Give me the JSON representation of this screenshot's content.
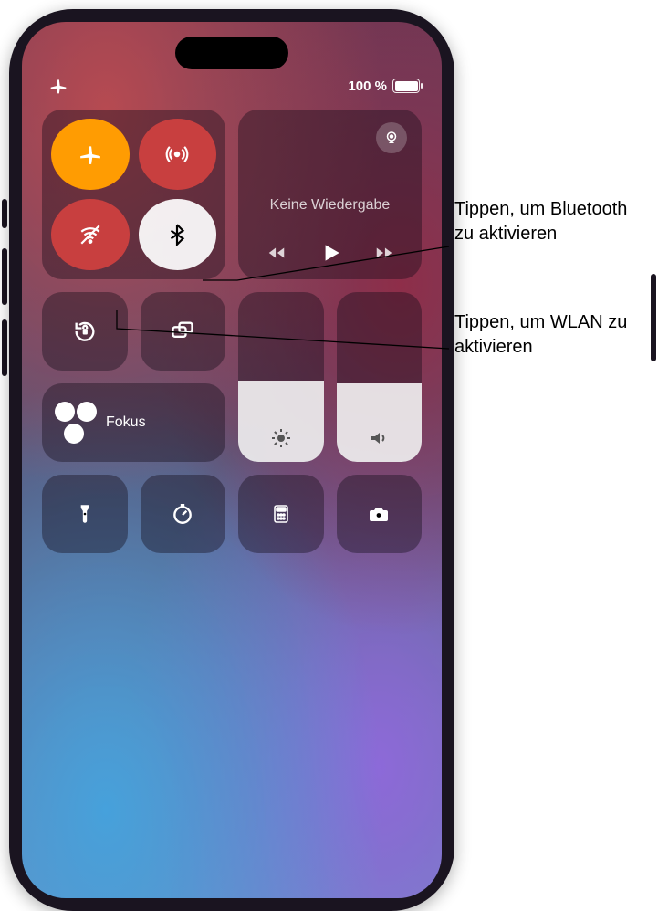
{
  "status_bar": {
    "airplane_mode": true,
    "battery_text": "100 %",
    "battery_fill_pct": 100
  },
  "connectivity": {
    "airplane": {
      "name": "airplane-mode",
      "active": true,
      "bg": "#ff9d0a"
    },
    "cellular": {
      "name": "cellular-data",
      "active": false,
      "bg": "#c34040"
    },
    "wifi": {
      "name": "wifi",
      "active": false,
      "bg": "#c34040"
    },
    "bluetooth": {
      "name": "bluetooth",
      "active": false,
      "bg": "rgba(255,255,255,0.92)"
    }
  },
  "media": {
    "now_playing_text": "Keine Wiedergabe",
    "airplay_name": "airplay"
  },
  "small_modules": {
    "orientation_lock": "orientation-lock",
    "screen_mirroring": "screen-mirroring"
  },
  "focus": {
    "label": "Fokus"
  },
  "sliders": {
    "brightness_pct": 48,
    "volume_pct": 46
  },
  "bottom_row": {
    "items": [
      "flashlight",
      "timer",
      "calculator",
      "camera"
    ]
  },
  "callouts": {
    "bluetooth": "Tippen, um Bluetooth zu aktivieren",
    "wifi": "Tippen, um WLAN zu aktivieren"
  }
}
